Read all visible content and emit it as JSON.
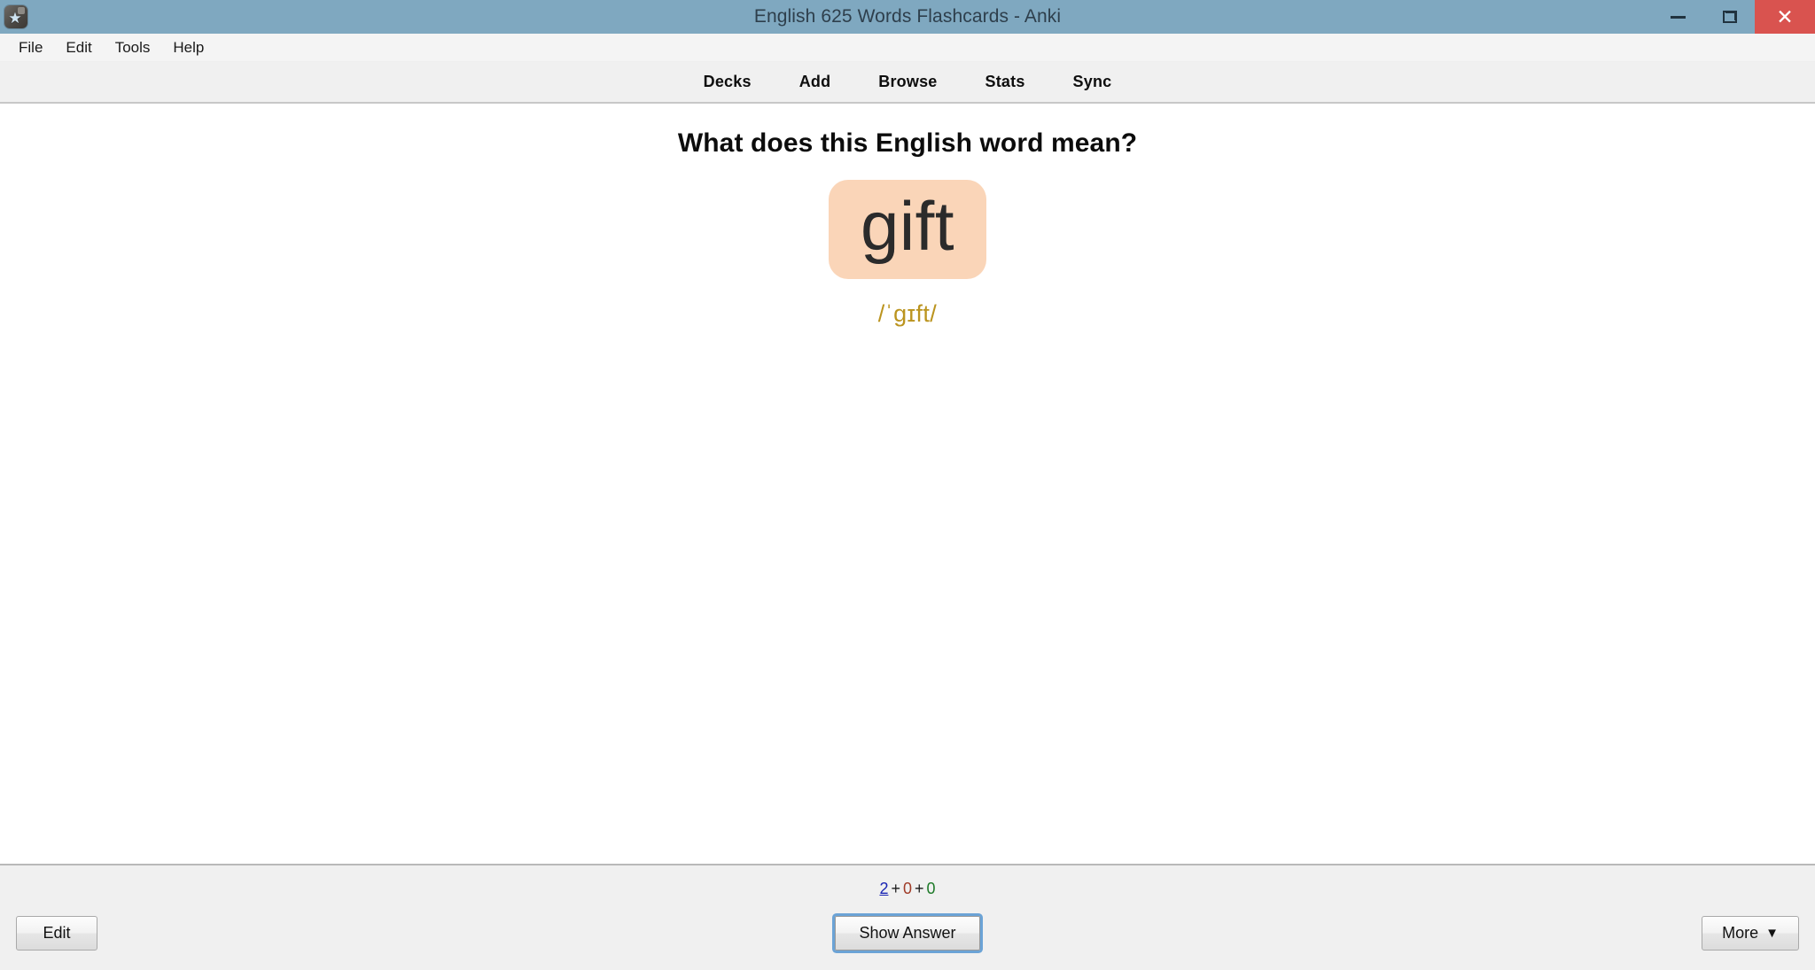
{
  "window": {
    "title": "English 625 Words Flashcards - Anki",
    "icon": "anki-star-icon",
    "controls": {
      "minimize": "minimize-icon",
      "maximize": "restore-icon",
      "close": "close-icon",
      "close_glyph": "✕"
    },
    "titlebar_color": "#7fa8c0",
    "close_color": "#d9534f"
  },
  "menu": {
    "items": [
      {
        "label": "File"
      },
      {
        "label": "Edit"
      },
      {
        "label": "Tools"
      },
      {
        "label": "Help"
      }
    ]
  },
  "toolbar": {
    "items": [
      {
        "label": "Decks"
      },
      {
        "label": "Add"
      },
      {
        "label": "Browse"
      },
      {
        "label": "Stats"
      },
      {
        "label": "Sync"
      }
    ]
  },
  "card": {
    "question": "What does this English word mean?",
    "word": "gift",
    "word_chip_color": "#fad5b8",
    "phonetic": "/ˈɡɪft/",
    "phonetic_color": "#bb941f"
  },
  "status": {
    "new_count": "2",
    "learning_count": "0",
    "review_count": "0",
    "separator": "+",
    "new_color": "#1924b3",
    "learning_color": "#a03c28",
    "review_color": "#1d7a28"
  },
  "buttons": {
    "edit": "Edit",
    "show_answer": "Show Answer",
    "more": "More",
    "more_caret": "▼"
  }
}
